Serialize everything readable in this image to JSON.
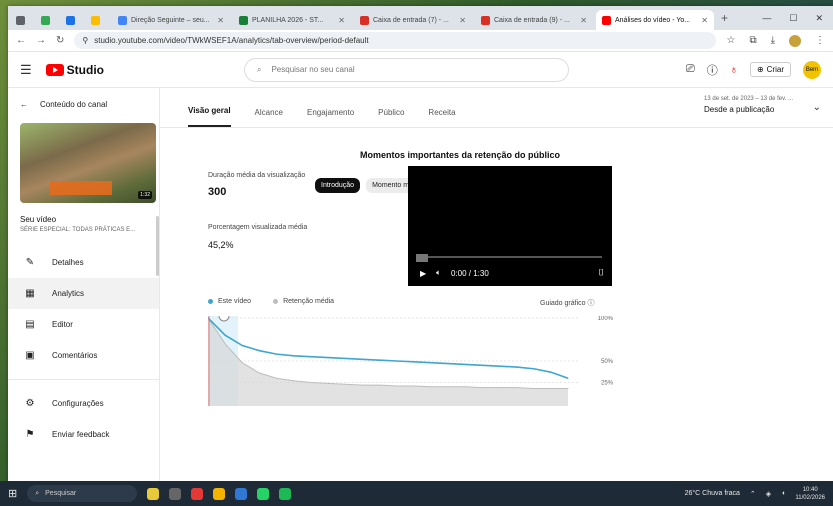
{
  "browser": {
    "tabs": [
      {
        "label": "",
        "color": "#5f6368"
      },
      {
        "label": "",
        "color": "#34a853"
      },
      {
        "label": "",
        "color": "#1a73e8"
      },
      {
        "label": "",
        "color": "#fbbc04"
      },
      {
        "label": "Direção Seguinte – seu...",
        "color": "#4285f4"
      },
      {
        "label": "PLANILHA 2026 - ST...",
        "color": "#188038"
      },
      {
        "label": "Caixa de entrada (7) - ...",
        "color": "#d93025"
      },
      {
        "label": "Caixa de entrada (9) - ...",
        "color": "#d93025"
      },
      {
        "label": "Análises do vídeo - Yo...",
        "color": "#ff0000"
      }
    ],
    "new_tab": "+",
    "url": "studio.youtube.com/video/TWkWSEF1A/analytics/tab-overview/period-default"
  },
  "header": {
    "logo_text": "Studio",
    "search_placeholder": "Pesquisar no seu canal",
    "create_label": "Criar",
    "avatar_text": "Bem"
  },
  "sidebar": {
    "back_label": "Conteúdo do canal",
    "thumb_duration": "1:32",
    "video_title": "Seu vídeo",
    "video_subtitle": "SÉRIE ESPECIAL: TODAS PRÁTICAS E...",
    "items": [
      {
        "label": "Detalhes",
        "icon": "pencil-icon"
      },
      {
        "label": "Analytics",
        "icon": "analytics-icon"
      },
      {
        "label": "Editor",
        "icon": "editor-icon"
      },
      {
        "label": "Comentários",
        "icon": "comments-icon"
      }
    ],
    "bottom_items": [
      {
        "label": "Configurações",
        "icon": "gear-icon"
      },
      {
        "label": "Enviar feedback",
        "icon": "feedback-icon"
      }
    ]
  },
  "main": {
    "tabs": [
      "Visão geral",
      "Alcance",
      "Engajamento",
      "Público",
      "Receita"
    ],
    "date_small": "13 de set. de 2023 – 13 de fev. ...",
    "date_value": "Desde a publicação",
    "section_title": "Momentos importantes da retenção do público",
    "chips": [
      "Introdução",
      "Momento mais importante"
    ],
    "avg_duration_label": "Duração média da visualização",
    "avg_duration_value": "300",
    "avg_pct_label": "Porcentagem visualizada média",
    "avg_pct_value": "45,2%",
    "player_time": "0:00 / 1:30",
    "legend_this": "Este vídeo",
    "legend_typical": "Retenção média",
    "guide_label": "Guiado gráfico",
    "y_labels": [
      "100%",
      "50%",
      "25%"
    ]
  },
  "chart_data": {
    "type": "area",
    "series": [
      {
        "name": "Este vídeo",
        "color": "#3ea6cf",
        "values": [
          100,
          80,
          68,
          62,
          58,
          56,
          55,
          54,
          53,
          52,
          51,
          50,
          49,
          48,
          47,
          46,
          45,
          44,
          43,
          41,
          37,
          30
        ]
      },
      {
        "name": "Retenção média",
        "color": "#bdbdbd",
        "values": [
          100,
          70,
          48,
          36,
          30,
          27,
          25,
          24,
          23,
          22,
          22,
          21,
          21,
          20,
          20,
          20,
          19,
          19,
          19,
          18,
          18,
          18
        ]
      }
    ],
    "ylim": [
      0,
      100
    ],
    "ylabel": "",
    "xlabel": ""
  },
  "taskbar": {
    "search_label": "Pesquisar",
    "weather": "26°C  Chuva fraca",
    "time": "10:40",
    "date": "11/02/2026"
  }
}
